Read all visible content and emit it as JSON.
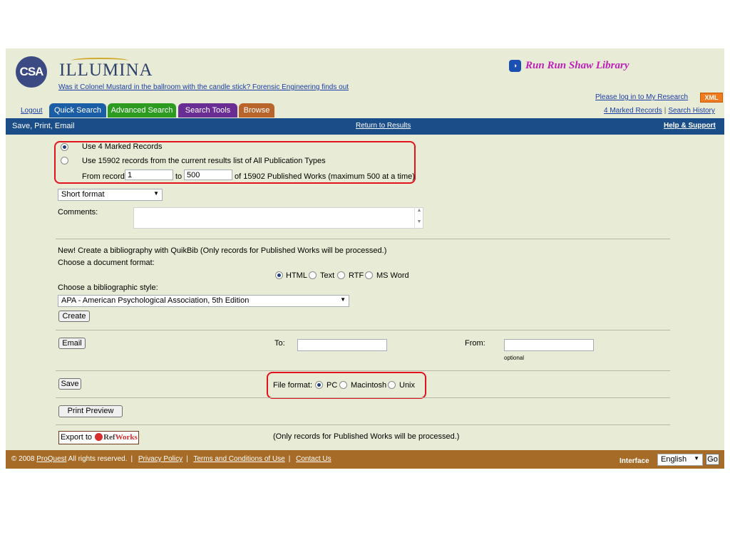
{
  "header": {
    "logo_text": "CSA",
    "product": "ILLUMINA",
    "tagline": "Was it Colonel Mustard in the ballroom with the candle stick? Forensic Engineering finds out",
    "library": "Run Run Shaw Library",
    "login_link": "Please log in to My Research",
    "xml_badge": "XML",
    "logout": "Logout",
    "tabs": [
      "Quick Search",
      "Advanced Search",
      "Search Tools",
      "Browse"
    ],
    "marked_records": "4 Marked Records",
    "search_history": "Search History",
    "separator": "|"
  },
  "titlebar": {
    "title": "Save, Print, Email",
    "return_link": "Return to Results",
    "help_link": "Help & Support"
  },
  "records": {
    "option_marked": "Use 4 Marked Records",
    "option_results": "Use 15902 records from the current results list of All Publication Types",
    "from_label": "From record",
    "from_value": "1",
    "to_label": "to",
    "to_value": "500",
    "range_note": "of 15902 Published Works (maximum 500 at a time)"
  },
  "format_select": "Short format",
  "comments_label": "Comments:",
  "quikbib": {
    "intro": "New! Create a bibliography with QuikBib (Only records for Published Works will be processed.)",
    "choose_format": "Choose a document format:",
    "formats": [
      "HTML",
      "Text",
      "RTF",
      "MS Word"
    ],
    "choose_style": "Choose a bibliographic style:",
    "style_select": "APA - American Psychological Association, 5th Edition",
    "create_button": "Create"
  },
  "email": {
    "button": "Email",
    "to_label": "To:",
    "from_label": "From:",
    "optional": "optional"
  },
  "save": {
    "button": "Save",
    "file_format_label": "File format:",
    "formats": [
      "PC",
      "Macintosh",
      "Unix"
    ]
  },
  "print_preview": "Print Preview",
  "export": {
    "prefix": "Export to",
    "brand_ref": "Ref",
    "brand_works": "Works",
    "note": "(Only records for Published Works will be processed.)"
  },
  "footer": {
    "copyright_prefix": "© 2008",
    "proquest": "ProQuest",
    "rights": "All rights reserved.",
    "privacy": "Privacy Policy",
    "terms": "Terms and Conditions of Use",
    "contact": "Contact Us",
    "interface_label": "Interface",
    "language": "English",
    "go": "Go"
  },
  "colors": {
    "page_bg": "#e8ebd5",
    "titlebar": "#1b4e88",
    "footer": "#a66c27",
    "highlight": "#e2131d",
    "tab_quick": "#1c5ea6",
    "tab_advanced": "#2c9b1f",
    "tab_tools": "#6a2d94",
    "tab_browse": "#b8642a"
  }
}
